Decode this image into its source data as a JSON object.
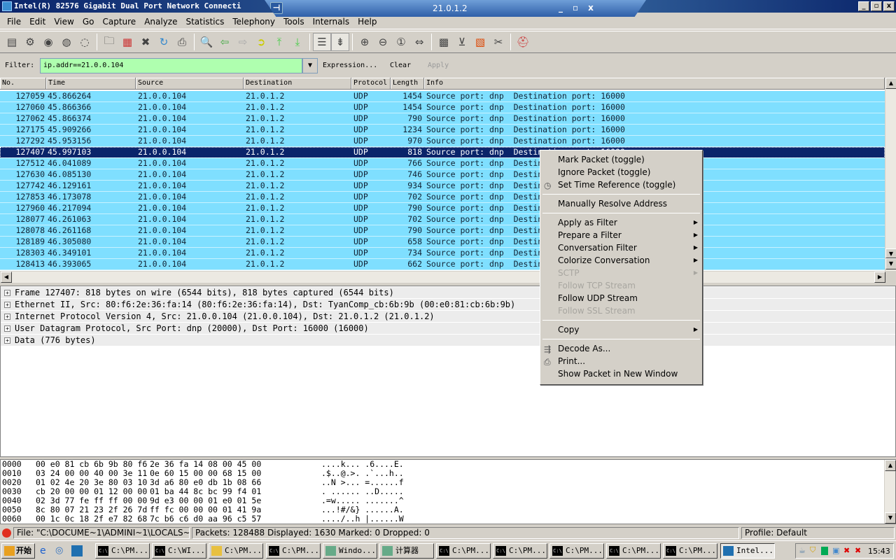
{
  "window": {
    "title": "Intel(R) 82576 Gigabit Dual Port Network Connecti",
    "minimize": "_",
    "maximize": "▫",
    "close": "x"
  },
  "remote_bar": {
    "host": "21.0.1.2",
    "pin": "⊣",
    "minimize": "_",
    "restore": "▫",
    "close": "x"
  },
  "menu": [
    "File",
    "Edit",
    "View",
    "Go",
    "Capture",
    "Analyze",
    "Statistics",
    "Telephony",
    "Tools",
    "Internals",
    "Help"
  ],
  "toolbar": {
    "icons": [
      "interfaces-icon",
      "options-icon",
      "start-icon",
      "stop-icon",
      "restart-icon",
      "open-icon",
      "save-icon",
      "close-icon",
      "reload-icon",
      "print-icon",
      "find-icon",
      "back-icon",
      "forward-icon",
      "goto-icon",
      "first-icon",
      "last-icon",
      "colorize-icon",
      "autoscroll-icon",
      "zoom-in-icon",
      "zoom-out-icon",
      "zoom-normal-icon",
      "resize-columns-icon",
      "capture-filters-icon",
      "display-filters-icon",
      "coloring-rules-icon",
      "preferences-icon",
      "help-icon"
    ]
  },
  "filter": {
    "label": "Filter:",
    "value": "ip.addr==21.0.0.104",
    "expression": "Expression...",
    "clear": "Clear",
    "apply": "Apply",
    "accent": "#afffaf"
  },
  "packet_list": {
    "columns": [
      "No.",
      "Time",
      "Source",
      "Destination",
      "Protocol",
      "Length",
      "Info"
    ],
    "row_color": "#7fdfff",
    "selected_color": "#0a246a",
    "selected_index": 5,
    "rows": [
      [
        "127059",
        "45.866264",
        "21.0.0.104",
        "21.0.1.2",
        "UDP",
        "1454",
        "Source port: dnp  Destination port: 16000"
      ],
      [
        "127060",
        "45.866366",
        "21.0.0.104",
        "21.0.1.2",
        "UDP",
        "1454",
        "Source port: dnp  Destination port: 16000"
      ],
      [
        "127062",
        "45.866374",
        "21.0.0.104",
        "21.0.1.2",
        "UDP",
        "790",
        "Source port: dnp  Destination port: 16000"
      ],
      [
        "127175",
        "45.909266",
        "21.0.0.104",
        "21.0.1.2",
        "UDP",
        "1234",
        "Source port: dnp  Destination port: 16000"
      ],
      [
        "127292",
        "45.953156",
        "21.0.0.104",
        "21.0.1.2",
        "UDP",
        "970",
        "Source port: dnp  Destination port: 16000"
      ],
      [
        "127407",
        "45.997103",
        "21.0.0.104",
        "21.0.1.2",
        "UDP",
        "818",
        "Source port: dnp  Destination port: 16000"
      ],
      [
        "127512",
        "46.041089",
        "21.0.0.104",
        "21.0.1.2",
        "UDP",
        "766",
        "Source port: dnp  Destination port: 16000"
      ],
      [
        "127630",
        "46.085130",
        "21.0.0.104",
        "21.0.1.2",
        "UDP",
        "746",
        "Source port: dnp  Destination port: 16000"
      ],
      [
        "127742",
        "46.129161",
        "21.0.0.104",
        "21.0.1.2",
        "UDP",
        "934",
        "Source port: dnp  Destination port: 16000"
      ],
      [
        "127853",
        "46.173078",
        "21.0.0.104",
        "21.0.1.2",
        "UDP",
        "702",
        "Source port: dnp  Destination port: 16000"
      ],
      [
        "127960",
        "46.217094",
        "21.0.0.104",
        "21.0.1.2",
        "UDP",
        "790",
        "Source port: dnp  Destination port: 16000"
      ],
      [
        "128077",
        "46.261063",
        "21.0.0.104",
        "21.0.1.2",
        "UDP",
        "702",
        "Source port: dnp  Destination port: 16000"
      ],
      [
        "128078",
        "46.261168",
        "21.0.0.104",
        "21.0.1.2",
        "UDP",
        "790",
        "Source port: dnp  Destination port: 16000"
      ],
      [
        "128189",
        "46.305080",
        "21.0.0.104",
        "21.0.1.2",
        "UDP",
        "658",
        "Source port: dnp  Destination port: 16000"
      ],
      [
        "128303",
        "46.349101",
        "21.0.0.104",
        "21.0.1.2",
        "UDP",
        "734",
        "Source port: dnp  Destination port: 16000"
      ],
      [
        "128413",
        "46.393065",
        "21.0.0.104",
        "21.0.1.2",
        "UDP",
        "662",
        "Source port: dnp  Destination port: 16000"
      ]
    ]
  },
  "details": [
    "Frame 127407: 818 bytes on wire (6544 bits), 818 bytes captured (6544 bits)",
    "Ethernet II, Src: 80:f6:2e:36:fa:14 (80:f6:2e:36:fa:14), Dst: TyanComp_cb:6b:9b (00:e0:81:cb:6b:9b)",
    "Internet Protocol Version 4, Src: 21.0.0.104 (21.0.0.104), Dst: 21.0.1.2 (21.0.1.2)",
    "User Datagram Protocol, Src Port: dnp (20000), Dst Port: 16000 (16000)",
    "Data (776 bytes)"
  ],
  "hex": [
    [
      "0000",
      "00 e0 81 cb 6b 9b 80 f6",
      "2e 36 fa 14 08 00 45 00",
      "....k... .6....E."
    ],
    [
      "0010",
      "03 24 00 00 40 00 3e 11",
      "0e 60 15 00 00 68 15 00",
      ".$..@.>. .`...h.."
    ],
    [
      "0020",
      "01 02 4e 20 3e 80 03 10",
      "3d a6 80 e0 db 1b 08 66",
      "..N >... =......f"
    ],
    [
      "0030",
      "cb 20 00 00 01 12 00 00",
      "01 ba 44 8c bc 99 f4 01",
      ". ...... ..D....."
    ],
    [
      "0040",
      "02 3d 77 fe ff ff 00 00",
      "9d e3 00 00 01 e0 01 5e",
      ".=w..... .......^"
    ],
    [
      "0050",
      "8c 80 07 21 23 2f 26 7d",
      "ff fc 00 00 00 01 41 9a",
      "...!#/&} ......A."
    ],
    [
      "0060",
      "00 1c 0c 18 2f e7 82 68",
      "7c b6 c6 d0 aa 96 c5 57",
      "..../..h |......W"
    ]
  ],
  "status": {
    "file": "File: \"C:\\DOCUME~1\\ADMINI~1\\LOCALS~...",
    "packets": "Packets: 128488 Displayed: 1630 Marked: 0 Dropped: 0",
    "profile": "Profile: Default"
  },
  "context_menu": [
    {
      "label": "Mark Packet (toggle)"
    },
    {
      "label": "Ignore Packet (toggle)"
    },
    {
      "label": "Set Time Reference (toggle)",
      "icon": "clock-icon"
    },
    {
      "sep": true
    },
    {
      "label": "Manually Resolve Address"
    },
    {
      "sep": true
    },
    {
      "label": "Apply as Filter",
      "submenu": true
    },
    {
      "label": "Prepare a Filter",
      "submenu": true
    },
    {
      "label": "Conversation Filter",
      "submenu": true
    },
    {
      "label": "Colorize Conversation",
      "submenu": true
    },
    {
      "label": "SCTP",
      "submenu": true,
      "disabled": true
    },
    {
      "label": "Follow TCP Stream",
      "disabled": true
    },
    {
      "label": "Follow UDP Stream"
    },
    {
      "label": "Follow SSL Stream",
      "disabled": true
    },
    {
      "sep": true
    },
    {
      "label": "Copy",
      "submenu": true
    },
    {
      "sep": true
    },
    {
      "label": "Decode As...",
      "icon": "decode-icon"
    },
    {
      "label": "Print...",
      "icon": "print-icon"
    },
    {
      "label": "Show Packet in New Window"
    }
  ],
  "taskbar": {
    "start": "开始",
    "tasks": [
      "C:\\PM...",
      "C:\\WI...",
      "C:\\PM...",
      "C:\\PM...",
      "Windo...",
      "计算器",
      "C:\\PM...",
      "C:\\PM...",
      "C:\\PM...",
      "C:\\PM...",
      "C:\\PM...",
      "Intel..."
    ],
    "clock": "15:43"
  }
}
